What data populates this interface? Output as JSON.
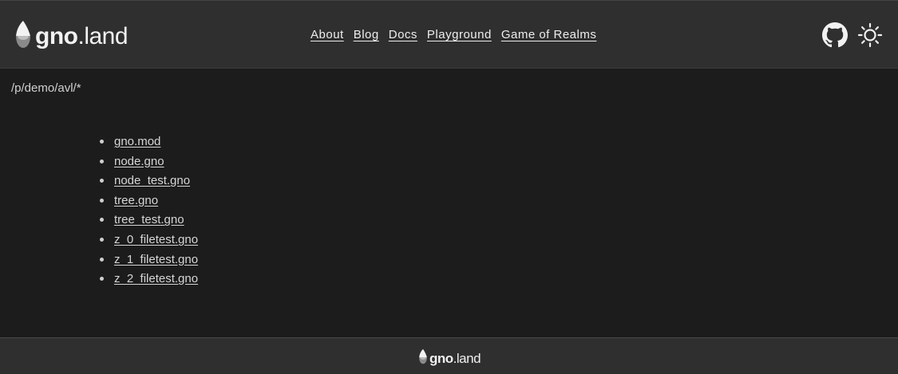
{
  "header": {
    "logo_bold": "gno",
    "logo_rest": ".land",
    "nav": [
      {
        "label": "About"
      },
      {
        "label": "Blog"
      },
      {
        "label": "Docs"
      },
      {
        "label": "Playground"
      },
      {
        "label": "Game of Realms"
      }
    ],
    "icons": [
      "github-icon",
      "sun-icon"
    ]
  },
  "main": {
    "path": "/p/demo/avl/*",
    "files": [
      "gno.mod",
      "node.gno",
      "node_test.gno",
      "tree.gno",
      "tree_test.gno",
      "z_0_filetest.gno",
      "z_1_filetest.gno",
      "z_2_filetest.gno"
    ]
  },
  "footer": {
    "logo_bold": "gno",
    "logo_rest": ".land"
  },
  "colors": {
    "background": "#1c1c1c",
    "header_bg": "#2f2f2f",
    "text": "#d8d8d8"
  }
}
